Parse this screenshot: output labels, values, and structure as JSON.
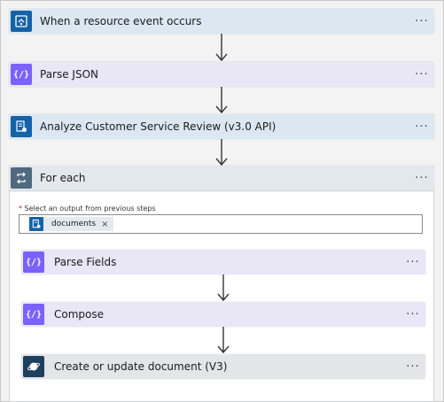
{
  "flow": {
    "steps": [
      {
        "label": "When a resource event occurs",
        "icon": "event-grid-icon"
      },
      {
        "label": "Parse JSON",
        "icon": "braces-icon"
      },
      {
        "label": "Analyze Customer Service Review (v3.0 API)",
        "icon": "document-analysis-icon"
      }
    ],
    "foreach": {
      "label": "For each",
      "icon": "loop-icon",
      "select_label": "Select an output from previous steps",
      "required_mark": "*",
      "token": {
        "label": "documents",
        "remove": "×"
      },
      "actions": [
        {
          "label": "Parse Fields",
          "icon": "braces-icon"
        },
        {
          "label": "Compose",
          "icon": "braces-icon"
        },
        {
          "label": "Create or update document (V3)",
          "icon": "cosmos-db-icon"
        }
      ]
    },
    "more_glyph": "···"
  },
  "colors": {
    "trigger_bg": "#dbe8f2",
    "trigger_icon": "#1462a8",
    "data_op_bg": "#e9e6f6",
    "data_op_icon": "#7b61ff",
    "foreach_bg": "#e3e7ee",
    "cosmos_icon": "#1e3f5e"
  }
}
